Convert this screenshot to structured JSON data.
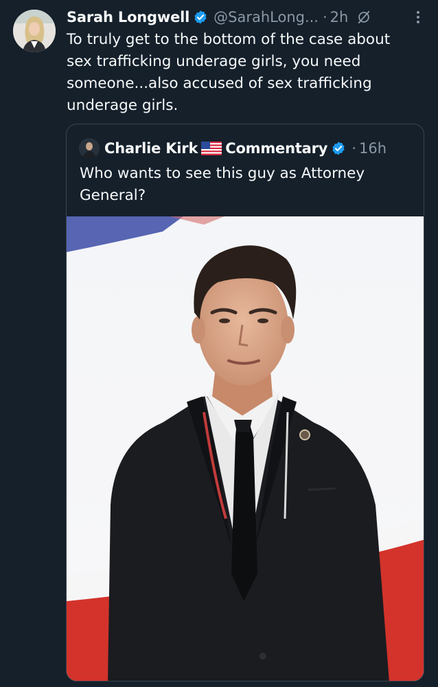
{
  "post": {
    "author_name": "Sarah Longwell",
    "handle": "@SarahLong...",
    "separator": "·",
    "time": "2h",
    "text": "To truly get to the bottom of the case about\nsex trafficking underage girls, you need\nsomeone...also accused of sex trafficking\nunderage girls.",
    "icons": [
      "verified-badge-icon",
      "grok-icon",
      "more-options-icon"
    ]
  },
  "quoted_post": {
    "author_name": "Charlie Kirk",
    "flag_emoji": "us-flag-icon",
    "author_suffix": "Commentary",
    "separator": "·",
    "time": "16h",
    "text": "Who wants to see this guy as Attorney General?",
    "image_description": "photo-man-dark-suit"
  },
  "colors": {
    "background": "#15202b",
    "text": "#f7f9f9",
    "secondary_text": "#8b98a5",
    "verified_blue": "#1d9bf0",
    "border": "#38444d"
  }
}
